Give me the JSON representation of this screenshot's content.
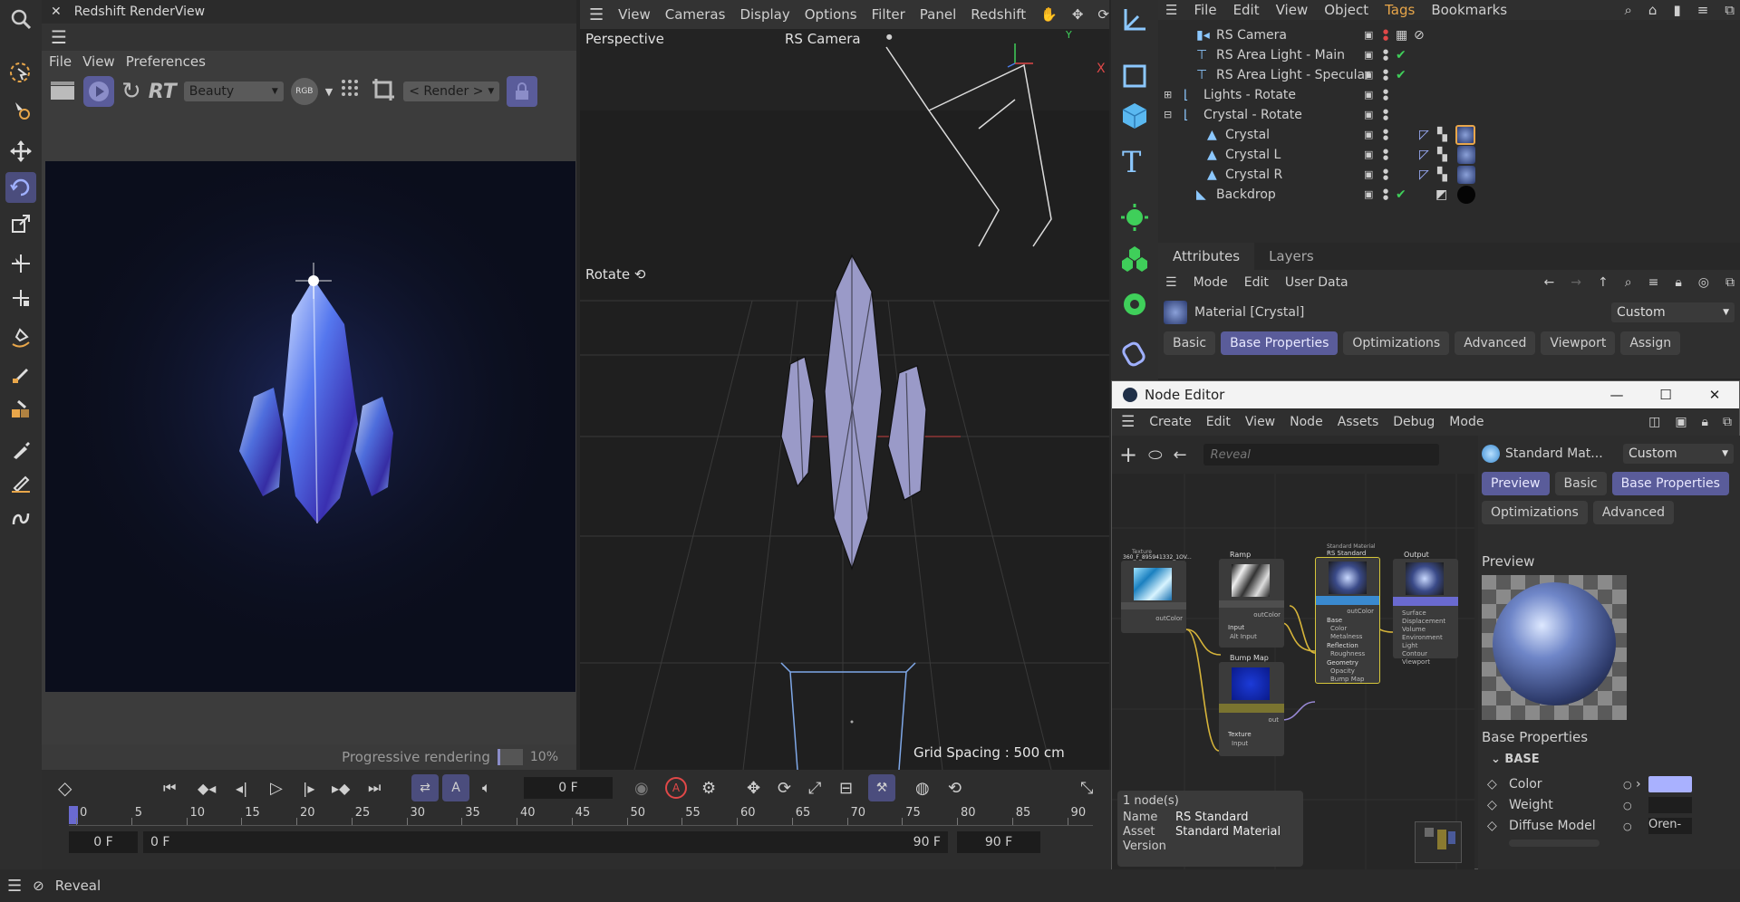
{
  "render_view": {
    "title": "Redshift RenderView",
    "menu": [
      "File",
      "View",
      "Preferences"
    ],
    "rt_label": "RT",
    "aov_value": "Beauty",
    "rgb_label": "RGB",
    "render_button": "< Render >",
    "progress_label": "Progressive rendering",
    "progress_value": "10%",
    "progress_fraction": 0.1
  },
  "viewport": {
    "menu": [
      "View",
      "Cameras",
      "Display",
      "Options",
      "Filter",
      "Panel",
      "Redshift"
    ],
    "view_name": "Perspective",
    "camera_name": "RS Camera",
    "tag_label": "Rotate",
    "grid_spacing": "Grid Spacing : 500 cm",
    "axis_y": "Y",
    "axis_x": "X"
  },
  "object_manager": {
    "menu": [
      "File",
      "Edit",
      "View",
      "Object",
      "Tags",
      "Bookmarks"
    ],
    "active_menu": "Tags",
    "rows": [
      {
        "name": "RS Camera",
        "indent": 0
      },
      {
        "name": "RS Area Light - Main",
        "indent": 0
      },
      {
        "name": "RS Area Light - Specular",
        "indent": 0
      },
      {
        "name": "Lights - Rotate",
        "indent": 0
      },
      {
        "name": "Crystal - Rotate",
        "indent": 0
      },
      {
        "name": "Crystal",
        "indent": 1
      },
      {
        "name": "Crystal L",
        "indent": 1
      },
      {
        "name": "Crystal R",
        "indent": 1
      },
      {
        "name": "Backdrop",
        "indent": 0
      }
    ]
  },
  "attributes": {
    "tabs": [
      "Attributes",
      "Layers"
    ],
    "menu": [
      "Mode",
      "Edit",
      "User Data"
    ],
    "material_title": "Material [Crystal]",
    "preset": "Custom",
    "prop_tabs": [
      "Basic",
      "Base Properties",
      "Optimizations",
      "Advanced",
      "Viewport",
      "Assign"
    ],
    "active_tab": "Base Properties"
  },
  "node_editor": {
    "title": "Node Editor",
    "menu": [
      "Create",
      "Edit",
      "View",
      "Node",
      "Assets",
      "Debug",
      "Mode"
    ],
    "search_placeholder": "Reveal",
    "nodes": {
      "texture_title": "Texture",
      "texture_name": "360_F_895941332_1OV...",
      "texture_out": "outColor",
      "ramp_name": "Ramp",
      "ramp_out": "outColor",
      "ramp_in_group": "Input",
      "ramp_in": "Alt Input",
      "bump_name": "Bump Map",
      "bump_out": "out",
      "bump_in_group": "Texture",
      "bump_in": "Input",
      "std_title": "Standard Material",
      "std_name": "RS Standard",
      "std_out": "outColor",
      "std_ports": [
        "Base",
        "Color",
        "Metalness",
        "Reflection",
        "Roughness",
        "Geometry",
        "Opacity",
        "Bump Map"
      ],
      "output_name": "Output",
      "output_ports": [
        "Surface",
        "Displacement",
        "Volume",
        "Environment",
        "Light",
        "Contour",
        "Viewport"
      ]
    },
    "info": {
      "count": "1 node(s)",
      "name_label": "Name",
      "name_value": "RS Standard",
      "asset_label": "Asset",
      "asset_value": "Standard Material",
      "version_label": "Version"
    },
    "props": {
      "title": "Standard Mat...",
      "preset": "Custom",
      "tabs": [
        "Preview",
        "Basic",
        "Base Properties",
        "Optimizations",
        "Advanced"
      ],
      "preview_heading": "Preview",
      "section_heading": "Base Properties",
      "group": "BASE",
      "rows": [
        {
          "label": "Color",
          "value": ""
        },
        {
          "label": "Weight",
          "value": ""
        },
        {
          "label": "Diffuse Model",
          "value": "Oren-"
        }
      ],
      "color_swatch": "#a9b1ff"
    }
  },
  "timeline": {
    "current_frame": "0 F",
    "ticks": [
      "0",
      "5",
      "10",
      "15",
      "20",
      "25",
      "30",
      "35",
      "40",
      "45",
      "50",
      "55",
      "60",
      "65",
      "70",
      "75",
      "80",
      "85",
      "90"
    ],
    "start_min": "0 F",
    "start": "0 F",
    "end": "90 F",
    "end_max": "90 F"
  },
  "status_bar": {
    "text": "Reveal"
  },
  "colors": {
    "accent": "#5a5c9a",
    "active_tool": "#4b4d7d",
    "green_check": "#3fcf5a",
    "red_dot": "#e04848"
  }
}
